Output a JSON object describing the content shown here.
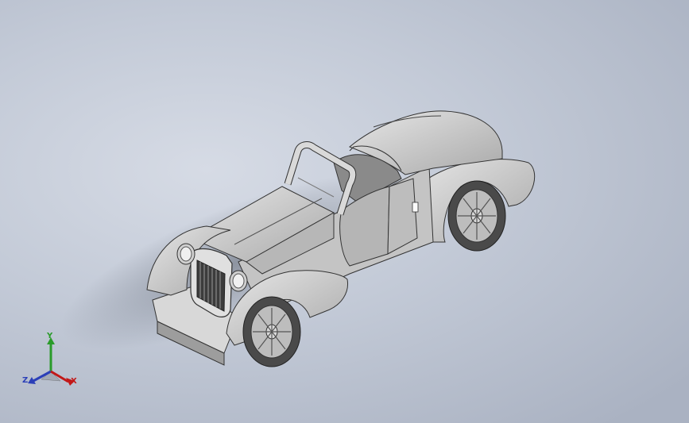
{
  "viewport": {
    "background_top": "#d6dbe5",
    "background_bottom": "#aab2c2",
    "model": "vintage-roadster-car"
  },
  "triad": {
    "x_label": "X",
    "y_label": "Y",
    "z_label": "Z",
    "x_color": "#c21818",
    "y_color": "#2a9b2a",
    "z_color": "#2b3fb8"
  }
}
